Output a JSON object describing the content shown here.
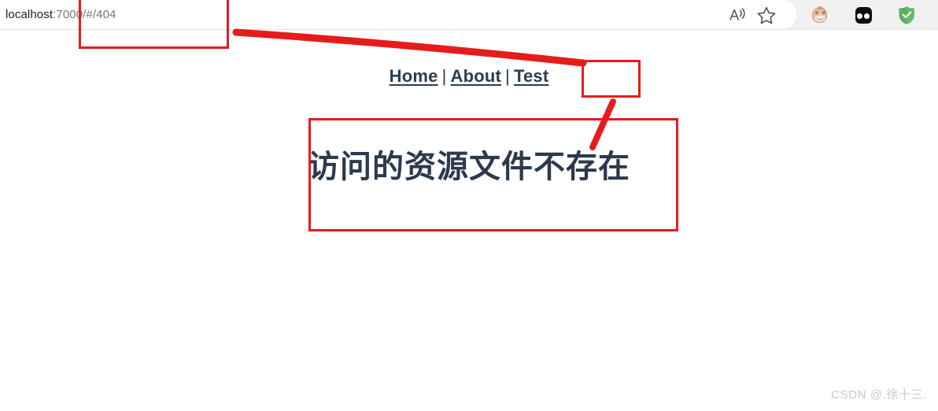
{
  "browser": {
    "url": {
      "host": "localhost",
      "rest": ":7000/#/404",
      "full": "localhost:7000/#/404"
    },
    "toolbar_icons": [
      {
        "name": "read-aloud-icon",
        "label": "Read aloud"
      },
      {
        "name": "favorite-star-icon",
        "label": "Add to favorites"
      },
      {
        "name": "tampermonkey-extension-icon",
        "label": "Tampermonkey"
      },
      {
        "name": "dark-extension-icon",
        "label": "Extension"
      },
      {
        "name": "adguard-shield-icon",
        "label": "AdGuard"
      }
    ]
  },
  "page": {
    "nav": {
      "items": [
        {
          "label": "Home"
        },
        {
          "label": "About"
        },
        {
          "label": "Test"
        }
      ],
      "separator": "|"
    },
    "error_message": "访问的资源文件不存在",
    "watermark": "CSDN @.徐十三."
  },
  "annotations": {
    "color": "#e81b1b",
    "boxes": [
      {
        "name": "url-highlight-box"
      },
      {
        "name": "test-link-highlight-box"
      },
      {
        "name": "error-message-highlight-box"
      }
    ],
    "arrows": [
      {
        "name": "url-to-test-arrow"
      },
      {
        "name": "test-to-message-arrow"
      }
    ]
  }
}
